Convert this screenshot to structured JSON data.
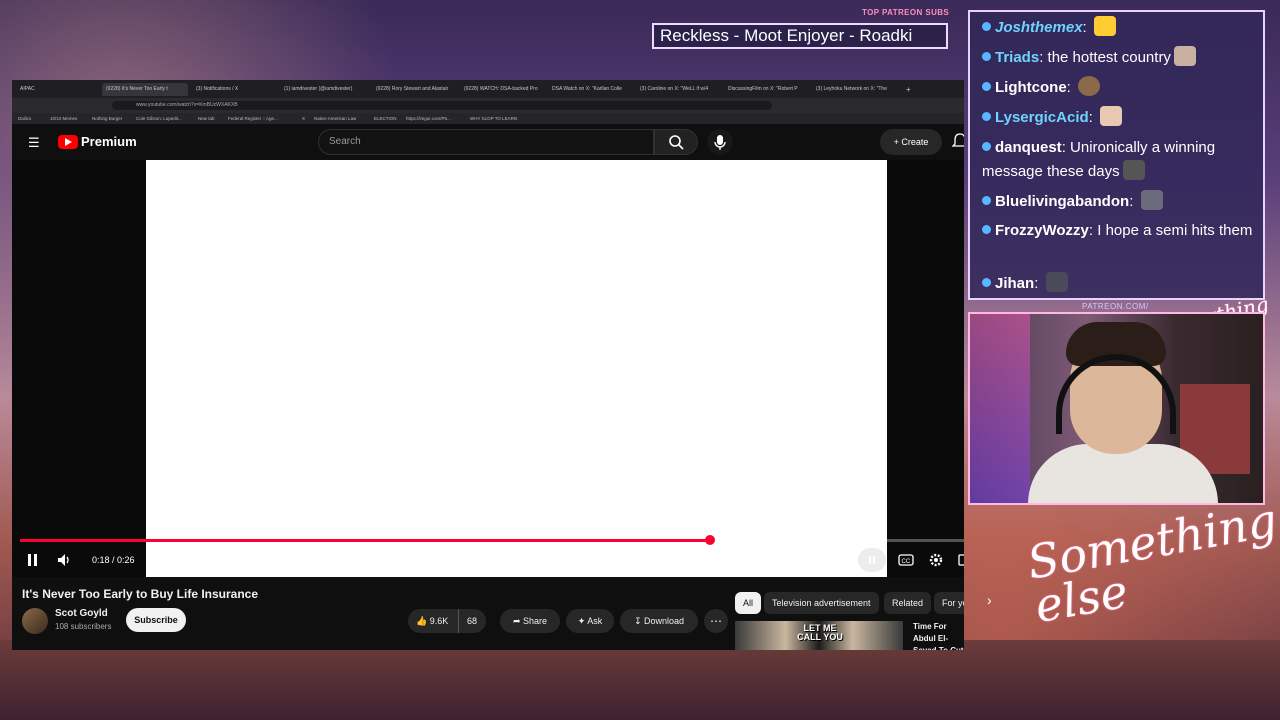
{
  "overlay": {
    "top_patreon_label": "TOP PATREON SUBS",
    "ticker_text": "Reckless - Moot Enjoyer - Roadki",
    "patreon_small": "PATREON.COM/",
    "signature_small": "Anything else",
    "signature_large": "Something else"
  },
  "chat": [
    {
      "name": "Joshthemex",
      "message": "",
      "name_color": "#6fd3ff",
      "emote": true
    },
    {
      "name": "Triads",
      "message": "the hottest country",
      "name_color": "#6fd3ff",
      "emote": true
    },
    {
      "name": "Lightcone",
      "message": "",
      "name_color": "#ffffff",
      "emote": true
    },
    {
      "name": "LysergicAcid",
      "message": "",
      "name_color": "#6fd3ff",
      "emote": true
    },
    {
      "name": "danquest",
      "message": "Unironically a winning message these days",
      "name_color": "#ffffff",
      "emote": true
    },
    {
      "name": "Bluelivingabandon",
      "message": "",
      "name_color": "#ffffff",
      "emote": true
    },
    {
      "name": "FrozzyWozzy",
      "message": "I hope a semi hits them",
      "name_color": "#ffffff",
      "emote": false
    },
    {
      "name": "Jihan",
      "message": "",
      "name_color": "#ffffff",
      "emote": true
    }
  ],
  "browser": {
    "tabs": [
      "AIPAC",
      "(9228) It's Never Too Early t",
      "(3) Notifications / X",
      "(1) iamdivester (@iamdivester)",
      "(9228) Rory Stewart and Alastair",
      "(9228) WATCH: DSA-backed Pro",
      "DSA Watch on X: \"Karllan Colle",
      "(3) Caroline on X: \"WeLL if w/4",
      "DiscussingFilm on X: \"Robert P",
      "(3) Leyhoku Network on X: \"The"
    ],
    "url": "www.youtube.com/watch?v=KmBUzWXAKXB",
    "bookmarks": [
      "Dailics",
      "10/10 Memes",
      "Nothing Burger",
      "Cole Gibson: Lupedit...",
      "New tab",
      "Federal Register :: Age...",
      "X",
      "Native American Law",
      "ELECTION",
      "https://imgur.com/P5...",
      "WHY SLOP TO LEARN"
    ]
  },
  "youtube": {
    "brand": "Premium",
    "search_placeholder": "Search",
    "create_label": "Create",
    "time_display": "0:18 / 0:26",
    "progress_fraction": 0.6923,
    "video_title": "It's Never Too Early to Buy Life Insurance",
    "channel_name": "Scot Goyld",
    "subscriber_count": "108 subscribers",
    "subscribe_label": "Subscribe",
    "like_count": "9.6K",
    "dislike_count": "68",
    "share_label": "Share",
    "ask_label": "Ask",
    "download_label": "Download",
    "chips": [
      "All",
      "Television advertisement",
      "Related",
      "For you"
    ],
    "recommended_thumb_text": "LET ME CALL YOU",
    "recommended_title": "Time For Abdul El-Sayed To Cut Ties With Hasan"
  },
  "colors": {
    "youtube_red": "#ff0000",
    "progress_red": "#ff0033",
    "chat_bg": "#32285a",
    "chat_border": "#e8d2ff"
  }
}
